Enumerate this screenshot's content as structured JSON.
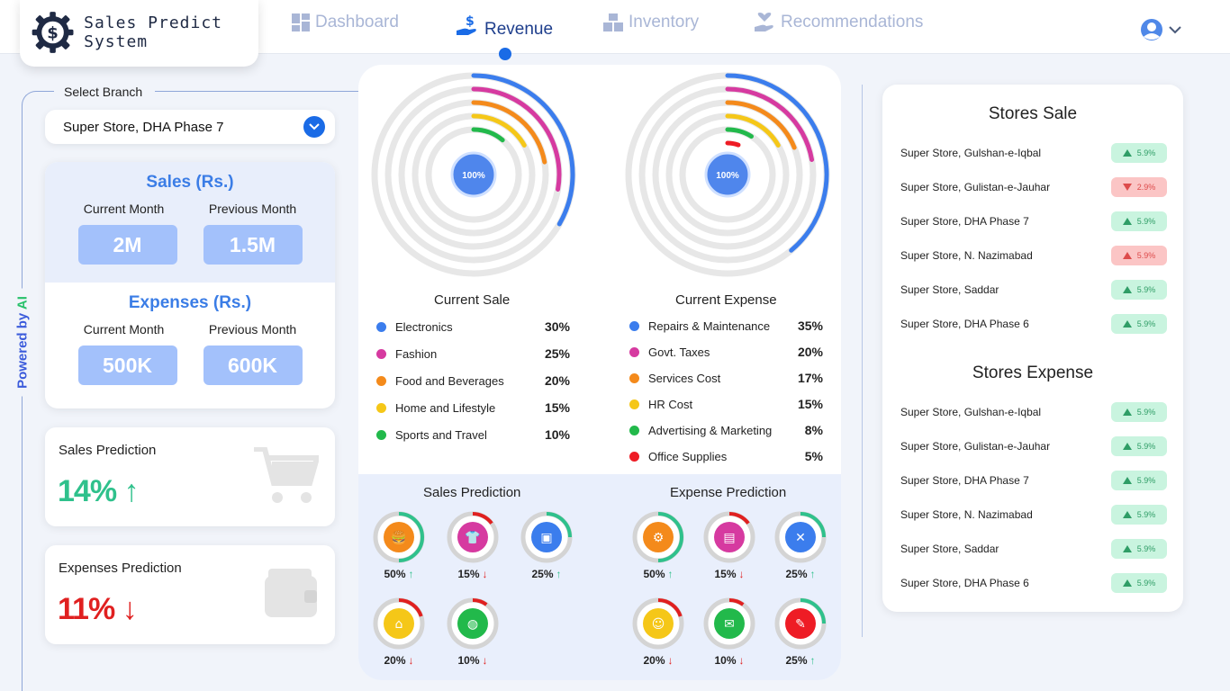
{
  "app": {
    "title": "Sales Predict System"
  },
  "nav": [
    {
      "label": "Dashboard",
      "icon": "grid-icon",
      "active": false
    },
    {
      "label": "Revenue",
      "icon": "hand-dollar-icon",
      "active": true
    },
    {
      "label": "Inventory",
      "icon": "boxes-icon",
      "active": false
    },
    {
      "label": "Recommendations",
      "icon": "hand-heart-icon",
      "active": false
    }
  ],
  "sidebar": {
    "powered_prefix": "Powered by",
    "powered_ai": "AI",
    "select_branch_label": "Select Branch",
    "selected_branch": "Super Store, DHA Phase 7"
  },
  "summary": {
    "sales": {
      "title": "Sales (Rs.)",
      "current_label": "Current Month",
      "previous_label": "Previous Month",
      "current": "2M",
      "previous": "1.5M"
    },
    "expenses": {
      "title": "Expenses (Rs.)",
      "current_label": "Current Month",
      "previous_label": "Previous Month",
      "current": "500K",
      "previous": "600K"
    }
  },
  "sales_prediction": {
    "title": "Sales Prediction",
    "value": "14%",
    "direction": "up",
    "color": "#2fc18c"
  },
  "expenses_prediction": {
    "title": "Expenses Prediction",
    "value": "11%",
    "direction": "down",
    "color": "#e02020"
  },
  "current_sale": {
    "label": "Current Sale",
    "center": "100%",
    "items": [
      {
        "name": "Electronics",
        "pct": "30%",
        "value": 30,
        "color": "#3b7ded"
      },
      {
        "name": "Fashion",
        "pct": "25%",
        "value": 25,
        "color": "#d63aa0"
      },
      {
        "name": "Food and Beverages",
        "pct": "20%",
        "value": 20,
        "color": "#f48a1b"
      },
      {
        "name": "Home and Lifestyle",
        "pct": "15%",
        "value": 15,
        "color": "#f5c718"
      },
      {
        "name": "Sports and Travel",
        "pct": "10%",
        "value": 10,
        "color": "#22b94b"
      }
    ]
  },
  "current_expense": {
    "label": "Current Expense",
    "center": "100%",
    "items": [
      {
        "name": "Repairs & Maintenance",
        "pct": "35%",
        "value": 35,
        "color": "#3b7ded"
      },
      {
        "name": "Govt. Taxes",
        "pct": "20%",
        "value": 20,
        "color": "#d63aa0"
      },
      {
        "name": "Services Cost",
        "pct": "17%",
        "value": 17,
        "color": "#f48a1b"
      },
      {
        "name": "HR Cost",
        "pct": "15%",
        "value": 15,
        "color": "#f5c718"
      },
      {
        "name": "Advertising & Marketing",
        "pct": "8%",
        "value": 8,
        "color": "#22b94b"
      },
      {
        "name": "Office Supplies",
        "pct": "5%",
        "value": 5,
        "color": "#ee1c25"
      }
    ]
  },
  "sales_pred": {
    "title": "Sales Prediction",
    "items": [
      {
        "pct": "50%",
        "value": 50,
        "dir": "up",
        "icon": "food-icon",
        "color": "#f48a1b"
      },
      {
        "pct": "15%",
        "value": 15,
        "dir": "down",
        "icon": "shirt-icon",
        "color": "#d63aa0"
      },
      {
        "pct": "25%",
        "value": 25,
        "dir": "up",
        "icon": "chip-icon",
        "color": "#3b7ded"
      },
      {
        "pct": "20%",
        "value": 20,
        "dir": "down",
        "icon": "home-icon",
        "color": "#f5c718"
      },
      {
        "pct": "10%",
        "value": 10,
        "dir": "down",
        "icon": "globe-icon",
        "color": "#22b94b"
      }
    ]
  },
  "expense_pred": {
    "title": "Expense Prediction",
    "items": [
      {
        "pct": "50%",
        "value": 50,
        "dir": "up",
        "icon": "repair-icon",
        "color": "#f48a1b"
      },
      {
        "pct": "15%",
        "value": 15,
        "dir": "down",
        "icon": "document-icon",
        "color": "#d63aa0"
      },
      {
        "pct": "25%",
        "value": 25,
        "dir": "up",
        "icon": "tools-icon",
        "color": "#3b7ded"
      },
      {
        "pct": "20%",
        "value": 20,
        "dir": "down",
        "icon": "employee-icon",
        "color": "#f5c718"
      },
      {
        "pct": "10%",
        "value": 10,
        "dir": "down",
        "icon": "marketing-icon",
        "color": "#22b94b"
      },
      {
        "pct": "25%",
        "value": 25,
        "dir": "up",
        "icon": "supplies-icon",
        "color": "#ee1c25"
      }
    ]
  },
  "stores_sale": {
    "title": "Stores Sale",
    "rows": [
      {
        "name": "Super Store, Gulshan-e-Iqbal",
        "change": "5.9%",
        "dir": "up"
      },
      {
        "name": "Super Store, Gulistan-e-Jauhar",
        "change": "2.9%",
        "dir": "down"
      },
      {
        "name": "Super Store, DHA Phase 7",
        "change": "5.9%",
        "dir": "up"
      },
      {
        "name": "Super Store, N. Nazimabad",
        "change": "5.9%",
        "dir": "up-red"
      },
      {
        "name": "Super Store, Saddar",
        "change": "5.9%",
        "dir": "up"
      },
      {
        "name": "Super Store, DHA Phase 6",
        "change": "5.9%",
        "dir": "up"
      }
    ]
  },
  "stores_expense": {
    "title": "Stores Expense",
    "rows": [
      {
        "name": "Super Store, Gulshan-e-Iqbal",
        "change": "5.9%",
        "dir": "up"
      },
      {
        "name": "Super Store, Gulistan-e-Jauhar",
        "change": "5.9%",
        "dir": "up"
      },
      {
        "name": "Super Store, DHA Phase 7",
        "change": "5.9%",
        "dir": "up"
      },
      {
        "name": "Super Store, N. Nazimabad",
        "change": "5.9%",
        "dir": "up"
      },
      {
        "name": "Super Store, Saddar",
        "change": "5.9%",
        "dir": "up"
      },
      {
        "name": "Super Store, DHA Phase 6",
        "change": "5.9%",
        "dir": "up"
      }
    ]
  },
  "colors": {
    "accent": "#1a6be6",
    "nav_inactive": "#a9b6d6",
    "nav_active": "#1e3e8c",
    "up": "#2fc18c",
    "down": "#e02020"
  }
}
